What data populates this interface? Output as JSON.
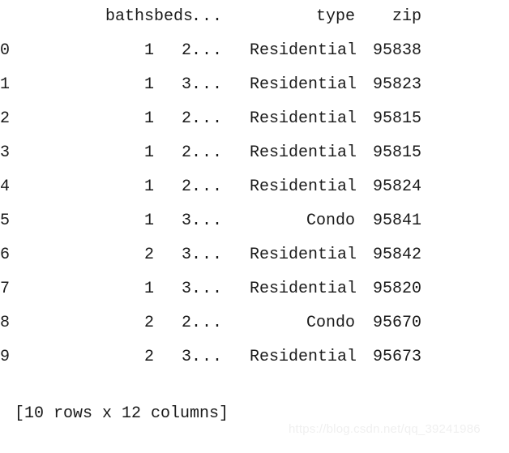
{
  "output": {
    "type": "pandas-dataframe-repr",
    "columns": {
      "index_header": "",
      "labels": [
        "baths",
        "beds",
        "...",
        "type",
        "zip"
      ]
    },
    "rows": [
      {
        "index": "0",
        "baths": "1",
        "beds": "2",
        "ellipsis": "...",
        "type": "Residential",
        "zip": "95838"
      },
      {
        "index": "1",
        "baths": "1",
        "beds": "3",
        "ellipsis": "...",
        "type": "Residential",
        "zip": "95823"
      },
      {
        "index": "2",
        "baths": "1",
        "beds": "2",
        "ellipsis": "...",
        "type": "Residential",
        "zip": "95815"
      },
      {
        "index": "3",
        "baths": "1",
        "beds": "2",
        "ellipsis": "...",
        "type": "Residential",
        "zip": "95815"
      },
      {
        "index": "4",
        "baths": "1",
        "beds": "2",
        "ellipsis": "...",
        "type": "Residential",
        "zip": "95824"
      },
      {
        "index": "5",
        "baths": "1",
        "beds": "3",
        "ellipsis": "...",
        "type": "Condo",
        "zip": "95841"
      },
      {
        "index": "6",
        "baths": "2",
        "beds": "3",
        "ellipsis": "...",
        "type": "Residential",
        "zip": "95842"
      },
      {
        "index": "7",
        "baths": "1",
        "beds": "3",
        "ellipsis": "...",
        "type": "Residential",
        "zip": "95820"
      },
      {
        "index": "8",
        "baths": "2",
        "beds": "2",
        "ellipsis": "...",
        "type": "Condo",
        "zip": "95670"
      },
      {
        "index": "9",
        "baths": "2",
        "beds": "3",
        "ellipsis": "...",
        "type": "Residential",
        "zip": "95673"
      }
    ],
    "footer": "[10 rows x 12 columns]",
    "shape": {
      "rows": 10,
      "columns": 12
    }
  },
  "watermark": {
    "text": "https://blog.csdn.net/qq_39241986"
  },
  "colors": {
    "background": "#ffffff",
    "text": "#1a1a1a",
    "watermark": "#f0f0f0"
  }
}
